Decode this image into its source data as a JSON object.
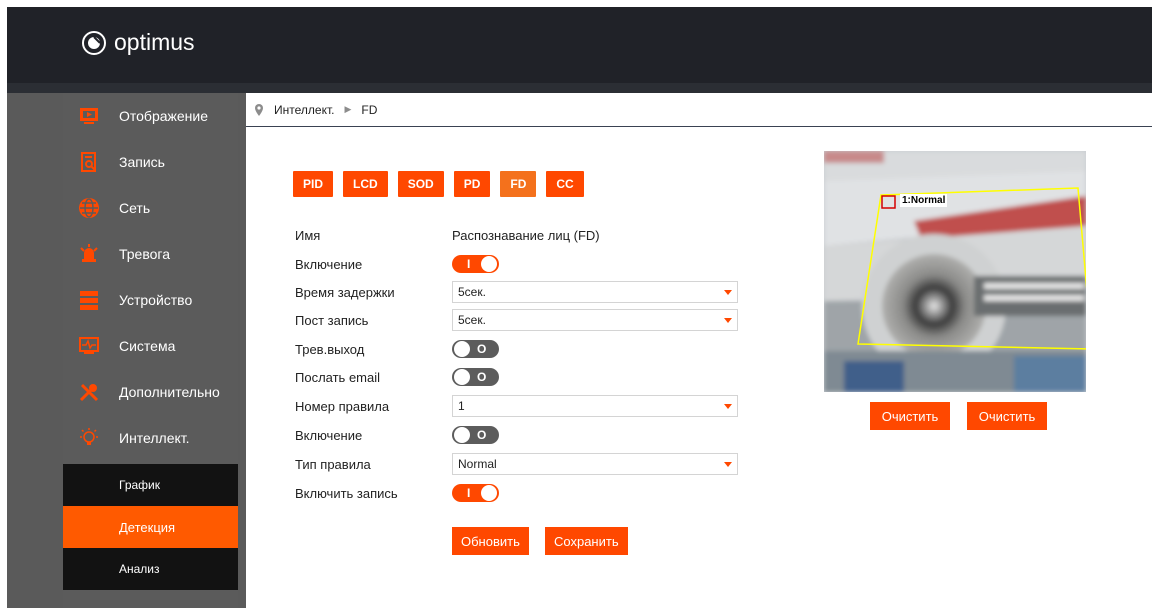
{
  "app": {
    "logo_text": "optimus"
  },
  "sidebar": {
    "items": [
      {
        "label": "Отображение",
        "icon": "monitor-icon"
      },
      {
        "label": "Запись",
        "icon": "record-search-icon"
      },
      {
        "label": "Сеть",
        "icon": "globe-icon"
      },
      {
        "label": "Тревога",
        "icon": "alarm-icon"
      },
      {
        "label": "Устройство",
        "icon": "storage-icon"
      },
      {
        "label": "Система",
        "icon": "system-monitor-icon"
      },
      {
        "label": "Дополнительно",
        "icon": "tools-icon"
      },
      {
        "label": "Интеллект.",
        "icon": "bulb-icon"
      }
    ],
    "subitems": [
      {
        "label": "График",
        "active": false
      },
      {
        "label": "Детекция",
        "active": true
      },
      {
        "label": "Анализ",
        "active": false
      }
    ]
  },
  "breadcrumb": {
    "parent": "Интеллект.",
    "current": "FD"
  },
  "tabs": [
    {
      "label": "PID",
      "active": false
    },
    {
      "label": "LCD",
      "active": false
    },
    {
      "label": "SOD",
      "active": false
    },
    {
      "label": "PD",
      "active": false
    },
    {
      "label": "FD",
      "active": true
    },
    {
      "label": "CC",
      "active": false
    }
  ],
  "form": {
    "name_label": "Имя",
    "name_value": "Распознавание лиц (FD)",
    "enable_label": "Включение",
    "enable_state": "on",
    "delay_label": "Время задержки",
    "delay_value": "5сек.",
    "post_record_label": "Пост запись",
    "post_record_value": "5сек.",
    "alarm_out_label": "Трев.выход",
    "alarm_out_state": "off",
    "email_label": "Послать email",
    "email_state": "off",
    "rule_number_label": "Номер правила",
    "rule_number_value": "1",
    "rule_enable_label": "Включение",
    "rule_enable_state": "off",
    "rule_type_label": "Тип правила",
    "rule_type_value": "Normal",
    "record_enable_label": "Включить запись",
    "record_enable_state": "on",
    "toggle_on_mark": "I",
    "toggle_off_mark": "O"
  },
  "actions": {
    "refresh_label": "Обновить",
    "save_label": "Сохранить"
  },
  "preview": {
    "roi_label": "1:Normal",
    "clear_button_1": "Очистить",
    "clear_button_2": "Очистить"
  },
  "colors": {
    "accent": "#ff4800",
    "active_tab": "#f4711c",
    "topbar": "#202228",
    "sidebar": "#5b5b5b",
    "roi_line": "#ffff00"
  }
}
